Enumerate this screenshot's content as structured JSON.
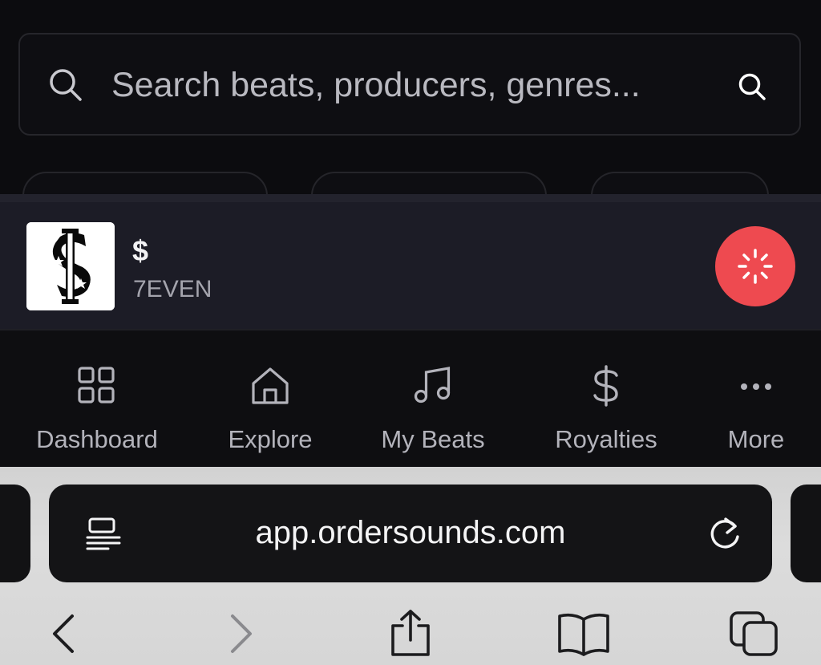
{
  "search": {
    "placeholder": "Search beats, producers, genres..."
  },
  "player": {
    "track_title": "$",
    "track_artist": "7EVEN",
    "cover_icon": "dollar-logo-icon",
    "play_button_icon": "loading-spinner-icon"
  },
  "nav": {
    "items": [
      {
        "label": "Dashboard",
        "icon": "grid-icon"
      },
      {
        "label": "Explore",
        "icon": "home-icon"
      },
      {
        "label": "My Beats",
        "icon": "music-note-icon"
      },
      {
        "label": "Royalties",
        "icon": "dollar-icon"
      },
      {
        "label": "More",
        "icon": "more-dots-icon"
      }
    ]
  },
  "browser": {
    "url": "app.ordersounds.com"
  },
  "colors": {
    "accent": "#ee4a50",
    "background": "#0b0b0e",
    "player_bg": "#1c1c26"
  }
}
